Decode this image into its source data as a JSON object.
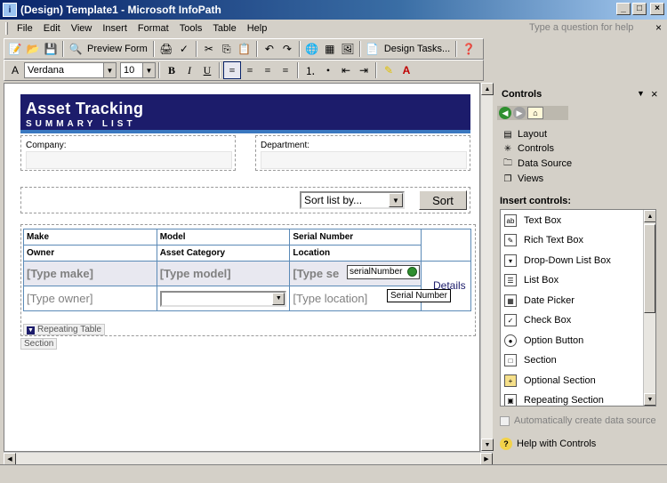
{
  "window": {
    "title": "(Design) Template1 - Microsoft InfoPath"
  },
  "menu": {
    "items": [
      "File",
      "Edit",
      "View",
      "Insert",
      "Format",
      "Tools",
      "Table",
      "Help"
    ],
    "help_placeholder": "Type a question for help"
  },
  "toolbar": {
    "preview_form": "Preview Form",
    "design_tasks": "Design Tasks...",
    "font": "Verdana",
    "size": "10"
  },
  "form": {
    "title": "Asset Tracking",
    "subtitle": "SUMMARY LIST",
    "company_label": "Company:",
    "department_label": "Department:",
    "sort_select": "Sort list by...",
    "sort_button": "Sort",
    "table_headers": [
      "Make",
      "Model",
      "Serial Number"
    ],
    "table_headers2": [
      "Owner",
      "Asset Category",
      "Location"
    ],
    "row1": [
      "[Type make]",
      "[Type model]",
      "[Type se"
    ],
    "row2": [
      "[Type owner]",
      "",
      "[Type location]"
    ],
    "serial_field": "serialNumber",
    "tooltip": "Serial Number",
    "details": "Details",
    "repeating_table_tag": "Repeating Table",
    "section_tag": "Section"
  },
  "taskpane": {
    "title": "Controls",
    "links": [
      "Layout",
      "Controls",
      "Data Source",
      "Views"
    ],
    "insert_title": "Insert controls:",
    "controls": [
      "Text Box",
      "Rich Text Box",
      "Drop-Down List Box",
      "List Box",
      "Date Picker",
      "Check Box",
      "Option Button",
      "Section",
      "Optional Section",
      "Repeating Section"
    ],
    "auto_create": "Automatically create data source",
    "help": "Help with Controls"
  },
  "colors": {
    "banner": "#1c1c6b",
    "banner_rule": "#3a78c0",
    "titlebar": "#0a246a"
  }
}
